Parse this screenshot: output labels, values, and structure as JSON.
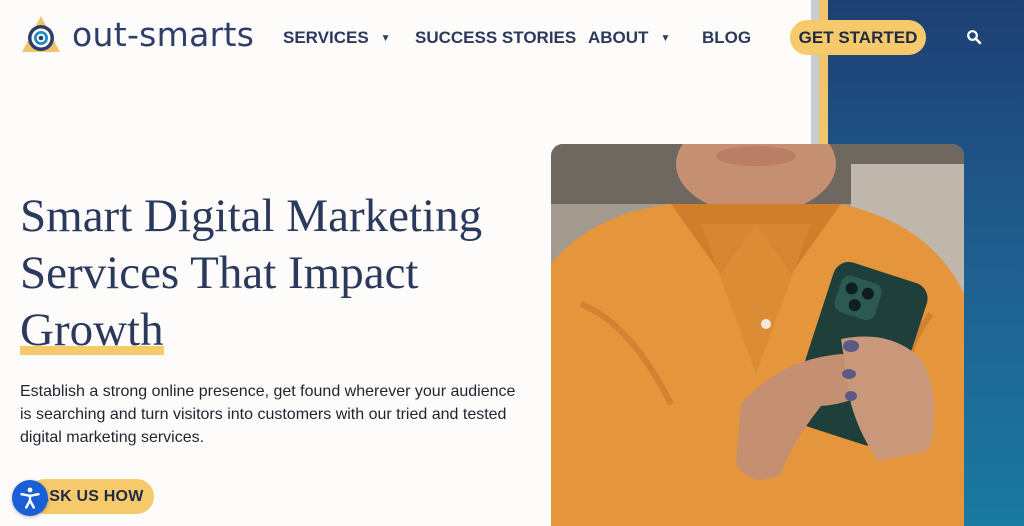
{
  "brand": {
    "name": "out-smarts"
  },
  "nav": {
    "services": "SERVICES",
    "success_stories": "SUCCESS STORIES",
    "about": "ABOUT",
    "blog": "BLOG",
    "get_started": "GET STARTED",
    "search_icon": "search-icon"
  },
  "hero": {
    "title_line1": "Smart Digital Marketing",
    "title_line2": "Services That Impact",
    "title_highlight": "Growth",
    "description": "Establish a strong online presence, get found wherever your audience is searching and turn visitors into customers with our tried and tested digital marketing services.",
    "ask_button": "ASK US HOW"
  },
  "colors": {
    "accent": "#f6c96b",
    "navy": "#2b3a5c",
    "blue_band": "#1f5f8f",
    "a11y_blue": "#1b5fd6"
  },
  "icons": {
    "accessibility": "accessibility-icon",
    "caret": "caret-down-icon"
  }
}
